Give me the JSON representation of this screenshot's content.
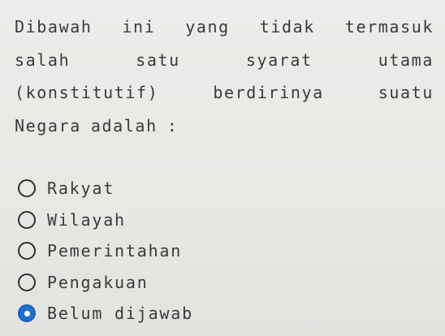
{
  "question": {
    "lines": [
      [
        "Dibawah",
        "ini",
        "yang",
        "tidak",
        "termasuk"
      ],
      [
        "salah",
        "satu",
        "syarat",
        "utama"
      ],
      [
        "(konstitutif)",
        "berdirinya",
        "suatu"
      ],
      [
        "Negara",
        "adalah",
        ":"
      ]
    ]
  },
  "options": [
    {
      "label": "Rakyat",
      "selected": false
    },
    {
      "label": "Wilayah",
      "selected": false
    },
    {
      "label": "Pemerintahan",
      "selected": false
    },
    {
      "label": "Pengakuan",
      "selected": false
    },
    {
      "label": "Belum dijawab",
      "selected": true
    }
  ],
  "colors": {
    "background": "#e9e9e6",
    "text": "#3a3a3a",
    "radio_selected": "#1f6fd1"
  }
}
